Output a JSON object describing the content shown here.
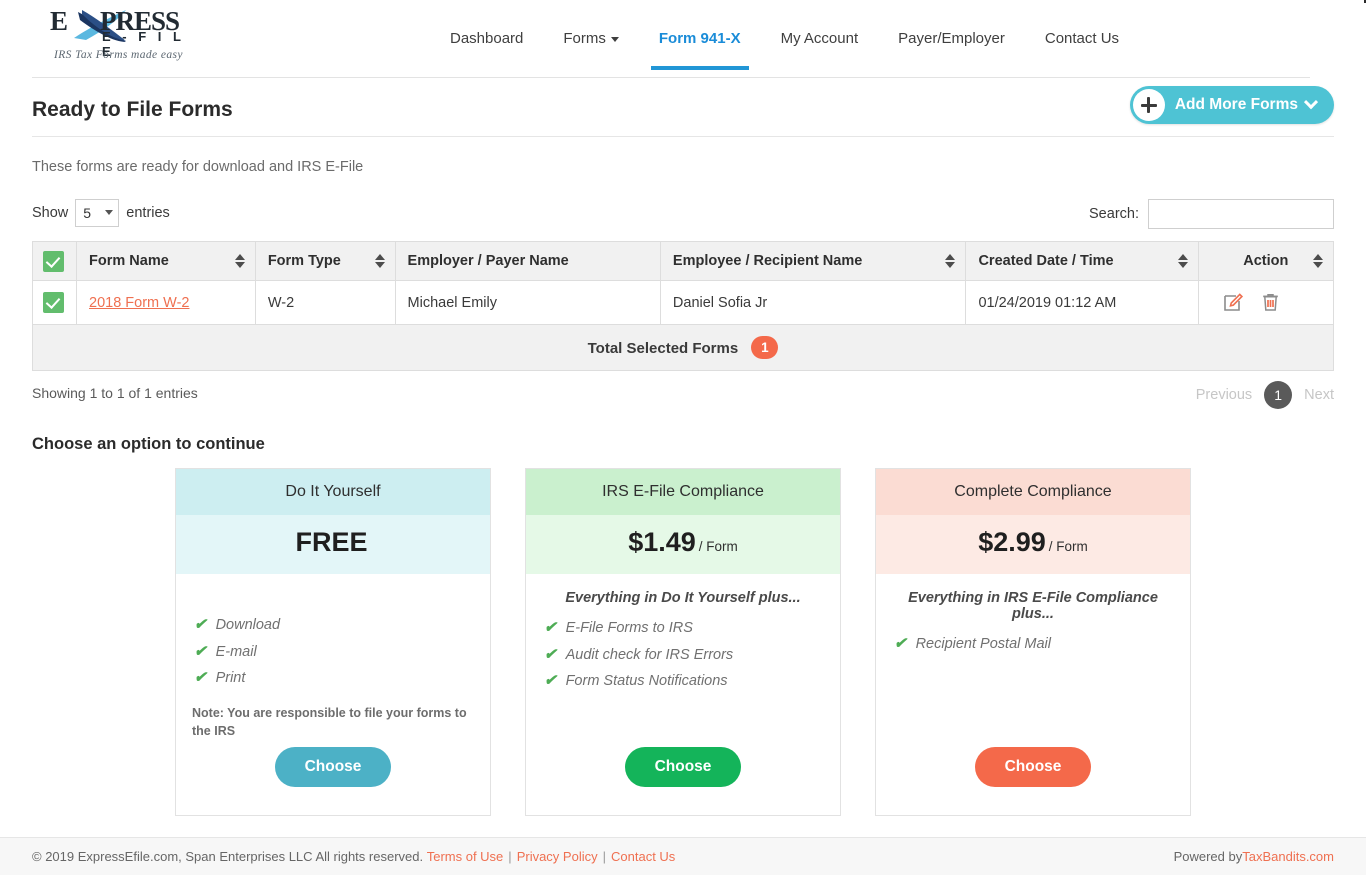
{
  "brand": {
    "logo_word_e": "E",
    "logo_word_press": "PRESS",
    "logo_efile": "E - F I L E",
    "logo_tagline": "IRS Tax Forms made easy",
    "accent_teal": "#4ec3d4",
    "accent_orange": "#ef7051",
    "accent_green": "#1db954",
    "nav_active_blue": "#1a8cd8"
  },
  "nav": {
    "items": [
      {
        "label": "Dashboard",
        "active": false,
        "caret": false
      },
      {
        "label": "Forms",
        "active": false,
        "caret": true
      },
      {
        "label": "Form 941-X",
        "active": true,
        "caret": false
      },
      {
        "label": "My Account",
        "active": false,
        "caret": false
      },
      {
        "label": "Payer/Employer",
        "active": false,
        "caret": false
      },
      {
        "label": "Contact Us",
        "active": false,
        "caret": false
      }
    ]
  },
  "page": {
    "title": "Ready to File Forms",
    "subtitle": "These forms are ready for download and IRS E-File",
    "add_forms_label": "Add More Forms"
  },
  "table_controls": {
    "show_label": "Show",
    "entries_value": "5",
    "entries_label": "entries",
    "search_label": "Search:",
    "search_value": "",
    "search_placeholder": ""
  },
  "table": {
    "headers": [
      "Form Name",
      "Form Type",
      "Employer / Payer Name",
      "Employee / Recipient Name",
      "Created Date / Time",
      "Action"
    ],
    "header_all_checked": true,
    "rows": [
      {
        "checked": true,
        "form_name": "2018 Form W-2",
        "form_type": "W-2",
        "employer": "Michael Emily",
        "employee": "Daniel Sofia Jr",
        "created": "01/24/2019 01:12 AM"
      }
    ],
    "total_label": "Total Selected Forms",
    "total_count": "1"
  },
  "table_footer": {
    "showing": "Showing 1 to 1 of 1 entries",
    "previous": "Previous",
    "page_number": "1",
    "next": "Next"
  },
  "options": {
    "section_title": "Choose an option to continue",
    "cards": [
      {
        "title": "Do It Yourself",
        "price": "FREE",
        "price_unit": "",
        "plus_line": "",
        "features": [
          "Download",
          "E-mail",
          "Print"
        ],
        "note": "Note: You are responsible to file your forms to the IRS",
        "button_label": "Choose",
        "head_bg": "#cdeef1",
        "price_bg": "#e3f6f8",
        "button_bg": "#4cb1c6"
      },
      {
        "title": "IRS E-File Compliance",
        "price": "$1.49",
        "price_unit": "/ Form",
        "plus_line": "Everything in Do It Yourself plus...",
        "features": [
          "E-File Forms to IRS",
          "Audit check for IRS Errors",
          "Form Status Notifications"
        ],
        "note": "",
        "button_label": "Choose",
        "head_bg": "#caf0ce",
        "price_bg": "#e5f9e7",
        "button_bg": "#14b45a"
      },
      {
        "title": "Complete Compliance",
        "price": "$2.99",
        "price_unit": "/ Form",
        "plus_line": "Everything in IRS E-File Compliance plus...",
        "features": [
          "Recipient Postal Mail"
        ],
        "note": "",
        "button_label": "Choose",
        "head_bg": "#fbdcd3",
        "price_bg": "#fdeae4",
        "button_bg": "#f4694a"
      }
    ]
  },
  "footer": {
    "copyright": "© 2019 ExpressEfile.com, Span Enterprises LLC All rights reserved.",
    "terms": "Terms of Use",
    "privacy": "Privacy Policy",
    "contact": "Contact Us",
    "powered_prefix": "Powered by ",
    "powered_link": "TaxBandits.com"
  }
}
